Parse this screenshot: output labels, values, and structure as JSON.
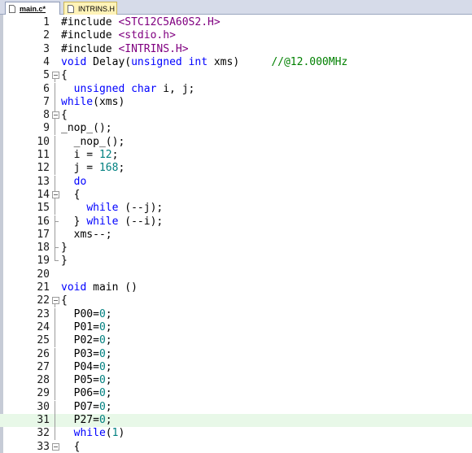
{
  "tabs": [
    {
      "label": "main.c*",
      "active": true
    },
    {
      "label": "INTRINS.H",
      "active": false
    }
  ],
  "colors": {
    "keyword": "#0000ff",
    "number": "#008080",
    "string": "#800080",
    "comment": "#008000",
    "current_line": "#e8f8e8"
  },
  "editor": {
    "current_line": 31,
    "lines": [
      {
        "n": "1",
        "tokens": [
          [
            "plain",
            "#include "
          ],
          [
            "str",
            "<STC12C5A60S2.H>"
          ]
        ]
      },
      {
        "n": "2",
        "tokens": [
          [
            "plain",
            "#include "
          ],
          [
            "str",
            "<stdio.h>"
          ]
        ]
      },
      {
        "n": "3",
        "tokens": [
          [
            "plain",
            "#include "
          ],
          [
            "str",
            "<INTRINS.H>"
          ]
        ]
      },
      {
        "n": "4",
        "tokens": [
          [
            "kw",
            "void"
          ],
          [
            "plain",
            " Delay("
          ],
          [
            "kw",
            "unsigned int"
          ],
          [
            "plain",
            " xms)     "
          ],
          [
            "cmt",
            "//@12.000MHz"
          ]
        ]
      },
      {
        "n": "5",
        "tokens": [
          [
            "plain",
            "{"
          ]
        ]
      },
      {
        "n": "6",
        "tokens": [
          [
            "plain",
            "  "
          ],
          [
            "kw",
            "unsigned char"
          ],
          [
            "plain",
            " i, j;"
          ]
        ]
      },
      {
        "n": "7",
        "tokens": [
          [
            "kw",
            "while"
          ],
          [
            "plain",
            "(xms)"
          ]
        ]
      },
      {
        "n": "8",
        "tokens": [
          [
            "plain",
            "{"
          ]
        ]
      },
      {
        "n": "9",
        "tokens": [
          [
            "plain",
            "_nop_();"
          ]
        ]
      },
      {
        "n": "10",
        "tokens": [
          [
            "plain",
            "  _nop_();"
          ]
        ]
      },
      {
        "n": "11",
        "tokens": [
          [
            "plain",
            "  i = "
          ],
          [
            "num",
            "12"
          ],
          [
            "plain",
            ";"
          ]
        ]
      },
      {
        "n": "12",
        "tokens": [
          [
            "plain",
            "  j = "
          ],
          [
            "num",
            "168"
          ],
          [
            "plain",
            ";"
          ]
        ]
      },
      {
        "n": "13",
        "tokens": [
          [
            "plain",
            "  "
          ],
          [
            "kw",
            "do"
          ]
        ]
      },
      {
        "n": "14",
        "tokens": [
          [
            "plain",
            "  {"
          ]
        ]
      },
      {
        "n": "15",
        "tokens": [
          [
            "plain",
            "    "
          ],
          [
            "kw",
            "while"
          ],
          [
            "plain",
            " (--j);"
          ]
        ]
      },
      {
        "n": "16",
        "tokens": [
          [
            "plain",
            "  } "
          ],
          [
            "kw",
            "while"
          ],
          [
            "plain",
            " (--i);"
          ]
        ]
      },
      {
        "n": "17",
        "tokens": [
          [
            "plain",
            "  xms--;"
          ]
        ]
      },
      {
        "n": "18",
        "tokens": [
          [
            "plain",
            "}"
          ]
        ]
      },
      {
        "n": "19",
        "tokens": [
          [
            "plain",
            "}"
          ]
        ]
      },
      {
        "n": "20",
        "tokens": []
      },
      {
        "n": "21",
        "tokens": [
          [
            "kw",
            "void"
          ],
          [
            "plain",
            " main ()"
          ]
        ]
      },
      {
        "n": "22",
        "tokens": [
          [
            "plain",
            "{"
          ]
        ]
      },
      {
        "n": "23",
        "tokens": [
          [
            "plain",
            "  P00="
          ],
          [
            "num",
            "0"
          ],
          [
            "plain",
            ";"
          ]
        ]
      },
      {
        "n": "24",
        "tokens": [
          [
            "plain",
            "  P01="
          ],
          [
            "num",
            "0"
          ],
          [
            "plain",
            ";"
          ]
        ]
      },
      {
        "n": "25",
        "tokens": [
          [
            "plain",
            "  P02="
          ],
          [
            "num",
            "0"
          ],
          [
            "plain",
            ";"
          ]
        ]
      },
      {
        "n": "26",
        "tokens": [
          [
            "plain",
            "  P03="
          ],
          [
            "num",
            "0"
          ],
          [
            "plain",
            ";"
          ]
        ]
      },
      {
        "n": "27",
        "tokens": [
          [
            "plain",
            "  P04="
          ],
          [
            "num",
            "0"
          ],
          [
            "plain",
            ";"
          ]
        ]
      },
      {
        "n": "28",
        "tokens": [
          [
            "plain",
            "  P05="
          ],
          [
            "num",
            "0"
          ],
          [
            "plain",
            ";"
          ]
        ]
      },
      {
        "n": "29",
        "tokens": [
          [
            "plain",
            "  P06="
          ],
          [
            "num",
            "0"
          ],
          [
            "plain",
            ";"
          ]
        ]
      },
      {
        "n": "30",
        "tokens": [
          [
            "plain",
            "  P07="
          ],
          [
            "num",
            "0"
          ],
          [
            "plain",
            ";"
          ]
        ]
      },
      {
        "n": "31",
        "tokens": [
          [
            "plain",
            "  P27="
          ],
          [
            "num",
            "0"
          ],
          [
            "plain",
            ";"
          ]
        ]
      },
      {
        "n": "32",
        "tokens": [
          [
            "plain",
            "  "
          ],
          [
            "kw",
            "while"
          ],
          [
            "plain",
            "("
          ],
          [
            "num",
            "1"
          ],
          [
            "plain",
            ")"
          ]
        ]
      },
      {
        "n": "33",
        "tokens": [
          [
            "plain",
            "  {"
          ]
        ]
      }
    ]
  }
}
